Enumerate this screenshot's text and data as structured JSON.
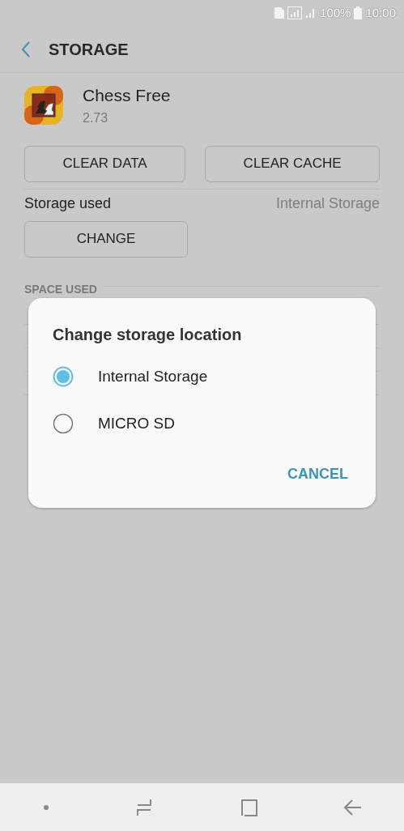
{
  "status_bar": {
    "battery": "100%",
    "time": "10:00"
  },
  "header": {
    "title": "STORAGE"
  },
  "app": {
    "name": "Chess Free",
    "version": "2.73"
  },
  "actions": [
    "CLEAR DATA",
    "CLEAR CACHE"
  ],
  "storage_used": {
    "label": "Storage used",
    "value": "Internal Storage",
    "button": "CHANGE"
  },
  "space_used": {
    "heading": "SPACE USED"
  },
  "dialog": {
    "title": "Change storage location",
    "options": [
      {
        "label": "Internal Storage",
        "selected": true
      },
      {
        "label": "MICRO SD",
        "selected": false
      }
    ],
    "button": "CANCEL"
  }
}
